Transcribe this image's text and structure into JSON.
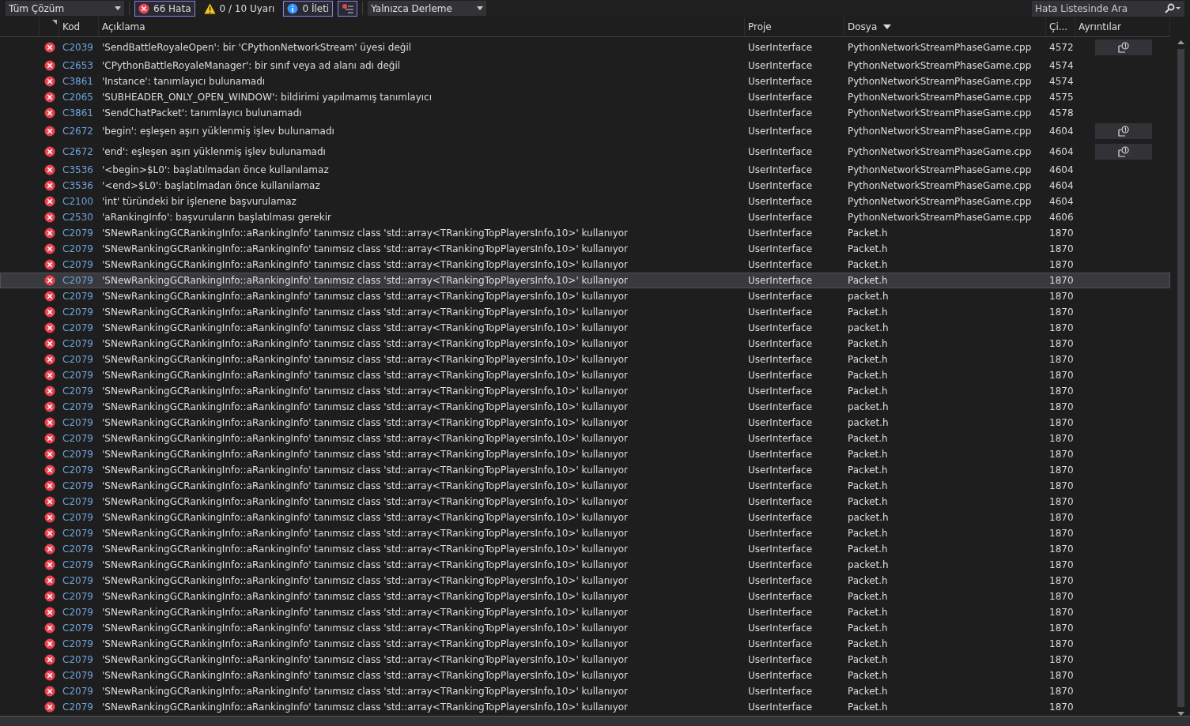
{
  "toolbar": {
    "scope": {
      "value": "Tüm Çözüm"
    },
    "filters": [
      {
        "kind": "error",
        "label": "66 Hata",
        "selected": true
      },
      {
        "kind": "warning",
        "label": "0 / 10 Uyarı",
        "selected": false
      },
      {
        "kind": "info",
        "label": "0 İleti",
        "selected": true
      }
    ],
    "filter_toggle": {
      "selected": true
    },
    "build_source": {
      "value": "Yalnızca Derleme"
    },
    "search": {
      "placeholder": "Hata Listesinde Ara"
    }
  },
  "table": {
    "columns": [
      {
        "label": "Kod"
      },
      {
        "label": "Açıklama"
      },
      {
        "label": "Proje"
      },
      {
        "label": "Dosya",
        "sorted": true
      },
      {
        "label": "Çi..."
      },
      {
        "label": "Ayrıntılar"
      }
    ],
    "rows": [
      {
        "code": "C2039",
        "description": "'SendBattleRoyaleOpen': bir 'CPythonNetworkStream' üyesi değil",
        "project": "UserInterface",
        "file": "PythonNetworkStreamPhaseGame.cpp",
        "line": "4572",
        "details": true,
        "selected": false
      },
      {
        "code": "C2653",
        "description": "'CPythonBattleRoyaleManager': bir sınıf veya ad alanı adı değil",
        "project": "UserInterface",
        "file": "PythonNetworkStreamPhaseGame.cpp",
        "line": "4574",
        "details": false,
        "selected": false
      },
      {
        "code": "C3861",
        "description": "'Instance': tanımlayıcı bulunamadı",
        "project": "UserInterface",
        "file": "PythonNetworkStreamPhaseGame.cpp",
        "line": "4574",
        "details": false,
        "selected": false
      },
      {
        "code": "C2065",
        "description": "'SUBHEADER_ONLY_OPEN_WINDOW': bildirimi yapılmamış tanımlayıcı",
        "project": "UserInterface",
        "file": "PythonNetworkStreamPhaseGame.cpp",
        "line": "4575",
        "details": false,
        "selected": false
      },
      {
        "code": "C3861",
        "description": "'SendChatPacket': tanımlayıcı bulunamadı",
        "project": "UserInterface",
        "file": "PythonNetworkStreamPhaseGame.cpp",
        "line": "4578",
        "details": false,
        "selected": false
      },
      {
        "code": "C2672",
        "description": "'begin': eşleşen aşırı yüklenmiş işlev bulunamadı",
        "project": "UserInterface",
        "file": "PythonNetworkStreamPhaseGame.cpp",
        "line": "4604",
        "details": true,
        "selected": false
      },
      {
        "code": "C2672",
        "description": "'end': eşleşen aşırı yüklenmiş işlev bulunamadı",
        "project": "UserInterface",
        "file": "PythonNetworkStreamPhaseGame.cpp",
        "line": "4604",
        "details": true,
        "selected": false
      },
      {
        "code": "C3536",
        "description": "'<begin>$L0': başlatılmadan önce kullanılamaz",
        "project": "UserInterface",
        "file": "PythonNetworkStreamPhaseGame.cpp",
        "line": "4604",
        "details": false,
        "selected": false
      },
      {
        "code": "C3536",
        "description": "'<end>$L0': başlatılmadan önce kullanılamaz",
        "project": "UserInterface",
        "file": "PythonNetworkStreamPhaseGame.cpp",
        "line": "4604",
        "details": false,
        "selected": false
      },
      {
        "code": "C2100",
        "description": "'int' türündeki bir işlenene başvurulamaz",
        "project": "UserInterface",
        "file": "PythonNetworkStreamPhaseGame.cpp",
        "line": "4604",
        "details": false,
        "selected": false
      },
      {
        "code": "C2530",
        "description": "'aRankingInfo': başvuruların başlatılması gerekir",
        "project": "UserInterface",
        "file": "PythonNetworkStreamPhaseGame.cpp",
        "line": "4606",
        "details": false,
        "selected": false
      },
      {
        "code": "C2079",
        "description": "'SNewRankingGCRankingInfo::aRankingInfo' tanımsız class 'std::array<TRankingTopPlayersInfo,10>' kullanıyor",
        "project": "UserInterface",
        "file": "Packet.h",
        "line": "1870",
        "details": false,
        "selected": false
      },
      {
        "code": "C2079",
        "description": "'SNewRankingGCRankingInfo::aRankingInfo' tanımsız class 'std::array<TRankingTopPlayersInfo,10>' kullanıyor",
        "project": "UserInterface",
        "file": "Packet.h",
        "line": "1870",
        "details": false,
        "selected": false
      },
      {
        "code": "C2079",
        "description": "'SNewRankingGCRankingInfo::aRankingInfo' tanımsız class 'std::array<TRankingTopPlayersInfo,10>' kullanıyor",
        "project": "UserInterface",
        "file": "Packet.h",
        "line": "1870",
        "details": false,
        "selected": false
      },
      {
        "code": "C2079",
        "description": "'SNewRankingGCRankingInfo::aRankingInfo' tanımsız class 'std::array<TRankingTopPlayersInfo,10>' kullanıyor",
        "project": "UserInterface",
        "file": "Packet.h",
        "line": "1870",
        "details": false,
        "selected": true
      },
      {
        "code": "C2079",
        "description": "'SNewRankingGCRankingInfo::aRankingInfo' tanımsız class 'std::array<TRankingTopPlayersInfo,10>' kullanıyor",
        "project": "UserInterface",
        "file": "packet.h",
        "line": "1870",
        "details": false,
        "selected": false
      },
      {
        "code": "C2079",
        "description": "'SNewRankingGCRankingInfo::aRankingInfo' tanımsız class 'std::array<TRankingTopPlayersInfo,10>' kullanıyor",
        "project": "UserInterface",
        "file": "Packet.h",
        "line": "1870",
        "details": false,
        "selected": false
      },
      {
        "code": "C2079",
        "description": "'SNewRankingGCRankingInfo::aRankingInfo' tanımsız class 'std::array<TRankingTopPlayersInfo,10>' kullanıyor",
        "project": "UserInterface",
        "file": "packet.h",
        "line": "1870",
        "details": false,
        "selected": false
      },
      {
        "code": "C2079",
        "description": "'SNewRankingGCRankingInfo::aRankingInfo' tanımsız class 'std::array<TRankingTopPlayersInfo,10>' kullanıyor",
        "project": "UserInterface",
        "file": "Packet.h",
        "line": "1870",
        "details": false,
        "selected": false
      },
      {
        "code": "C2079",
        "description": "'SNewRankingGCRankingInfo::aRankingInfo' tanımsız class 'std::array<TRankingTopPlayersInfo,10>' kullanıyor",
        "project": "UserInterface",
        "file": "Packet.h",
        "line": "1870",
        "details": false,
        "selected": false
      },
      {
        "code": "C2079",
        "description": "'SNewRankingGCRankingInfo::aRankingInfo' tanımsız class 'std::array<TRankingTopPlayersInfo,10>' kullanıyor",
        "project": "UserInterface",
        "file": "Packet.h",
        "line": "1870",
        "details": false,
        "selected": false
      },
      {
        "code": "C2079",
        "description": "'SNewRankingGCRankingInfo::aRankingInfo' tanımsız class 'std::array<TRankingTopPlayersInfo,10>' kullanıyor",
        "project": "UserInterface",
        "file": "Packet.h",
        "line": "1870",
        "details": false,
        "selected": false
      },
      {
        "code": "C2079",
        "description": "'SNewRankingGCRankingInfo::aRankingInfo' tanımsız class 'std::array<TRankingTopPlayersInfo,10>' kullanıyor",
        "project": "UserInterface",
        "file": "packet.h",
        "line": "1870",
        "details": false,
        "selected": false
      },
      {
        "code": "C2079",
        "description": "'SNewRankingGCRankingInfo::aRankingInfo' tanımsız class 'std::array<TRankingTopPlayersInfo,10>' kullanıyor",
        "project": "UserInterface",
        "file": "packet.h",
        "line": "1870",
        "details": false,
        "selected": false
      },
      {
        "code": "C2079",
        "description": "'SNewRankingGCRankingInfo::aRankingInfo' tanımsız class 'std::array<TRankingTopPlayersInfo,10>' kullanıyor",
        "project": "UserInterface",
        "file": "Packet.h",
        "line": "1870",
        "details": false,
        "selected": false
      },
      {
        "code": "C2079",
        "description": "'SNewRankingGCRankingInfo::aRankingInfo' tanımsız class 'std::array<TRankingTopPlayersInfo,10>' kullanıyor",
        "project": "UserInterface",
        "file": "Packet.h",
        "line": "1870",
        "details": false,
        "selected": false
      },
      {
        "code": "C2079",
        "description": "'SNewRankingGCRankingInfo::aRankingInfo' tanımsız class 'std::array<TRankingTopPlayersInfo,10>' kullanıyor",
        "project": "UserInterface",
        "file": "Packet.h",
        "line": "1870",
        "details": false,
        "selected": false
      },
      {
        "code": "C2079",
        "description": "'SNewRankingGCRankingInfo::aRankingInfo' tanımsız class 'std::array<TRankingTopPlayersInfo,10>' kullanıyor",
        "project": "UserInterface",
        "file": "Packet.h",
        "line": "1870",
        "details": false,
        "selected": false
      },
      {
        "code": "C2079",
        "description": "'SNewRankingGCRankingInfo::aRankingInfo' tanımsız class 'std::array<TRankingTopPlayersInfo,10>' kullanıyor",
        "project": "UserInterface",
        "file": "Packet.h",
        "line": "1870",
        "details": false,
        "selected": false
      },
      {
        "code": "C2079",
        "description": "'SNewRankingGCRankingInfo::aRankingInfo' tanımsız class 'std::array<TRankingTopPlayersInfo,10>' kullanıyor",
        "project": "UserInterface",
        "file": "packet.h",
        "line": "1870",
        "details": false,
        "selected": false
      },
      {
        "code": "C2079",
        "description": "'SNewRankingGCRankingInfo::aRankingInfo' tanımsız class 'std::array<TRankingTopPlayersInfo,10>' kullanıyor",
        "project": "UserInterface",
        "file": "Packet.h",
        "line": "1870",
        "details": false,
        "selected": false
      },
      {
        "code": "C2079",
        "description": "'SNewRankingGCRankingInfo::aRankingInfo' tanımsız class 'std::array<TRankingTopPlayersInfo,10>' kullanıyor",
        "project": "UserInterface",
        "file": "Packet.h",
        "line": "1870",
        "details": false,
        "selected": false
      },
      {
        "code": "C2079",
        "description": "'SNewRankingGCRankingInfo::aRankingInfo' tanımsız class 'std::array<TRankingTopPlayersInfo,10>' kullanıyor",
        "project": "UserInterface",
        "file": "packet.h",
        "line": "1870",
        "details": false,
        "selected": false
      },
      {
        "code": "C2079",
        "description": "'SNewRankingGCRankingInfo::aRankingInfo' tanımsız class 'std::array<TRankingTopPlayersInfo,10>' kullanıyor",
        "project": "UserInterface",
        "file": "Packet.h",
        "line": "1870",
        "details": false,
        "selected": false
      },
      {
        "code": "C2079",
        "description": "'SNewRankingGCRankingInfo::aRankingInfo' tanımsız class 'std::array<TRankingTopPlayersInfo,10>' kullanıyor",
        "project": "UserInterface",
        "file": "Packet.h",
        "line": "1870",
        "details": false,
        "selected": false
      },
      {
        "code": "C2079",
        "description": "'SNewRankingGCRankingInfo::aRankingInfo' tanımsız class 'std::array<TRankingTopPlayersInfo,10>' kullanıyor",
        "project": "UserInterface",
        "file": "Packet.h",
        "line": "1870",
        "details": false,
        "selected": false
      },
      {
        "code": "C2079",
        "description": "'SNewRankingGCRankingInfo::aRankingInfo' tanımsız class 'std::array<TRankingTopPlayersInfo,10>' kullanıyor",
        "project": "UserInterface",
        "file": "Packet.h",
        "line": "1870",
        "details": false,
        "selected": false
      },
      {
        "code": "C2079",
        "description": "'SNewRankingGCRankingInfo::aRankingInfo' tanımsız class 'std::array<TRankingTopPlayersInfo,10>' kullanıyor",
        "project": "UserInterface",
        "file": "Packet.h",
        "line": "1870",
        "details": false,
        "selected": false
      },
      {
        "code": "C2079",
        "description": "'SNewRankingGCRankingInfo::aRankingInfo' tanımsız class 'std::array<TRankingTopPlayersInfo,10>' kullanıyor",
        "project": "UserInterface",
        "file": "Packet.h",
        "line": "1870",
        "details": false,
        "selected": false
      },
      {
        "code": "C2079",
        "description": "'SNewRankingGCRankingInfo::aRankingInfo' tanımsız class 'std::array<TRankingTopPlayersInfo,10>' kullanıyor",
        "project": "UserInterface",
        "file": "Packet.h",
        "line": "1870",
        "details": false,
        "selected": false
      },
      {
        "code": "C2079",
        "description": "'SNewRankingGCRankingInfo::aRankingInfo' tanımsız class 'std::array<TRankingTopPlayersInfo,10>' kullanıyor",
        "project": "UserInterface",
        "file": "Packet.h",
        "line": "1870",
        "details": false,
        "selected": false
      },
      {
        "code": "C2079",
        "description": "'SNewRankingGCRankingInfo::aRankingInfo' tanımsız class 'std::array<TRankingTopPlayersInfo,10>' kullanıyor",
        "project": "UserInterface",
        "file": "Packet.h",
        "line": "1870",
        "details": false,
        "selected": false
      }
    ]
  }
}
